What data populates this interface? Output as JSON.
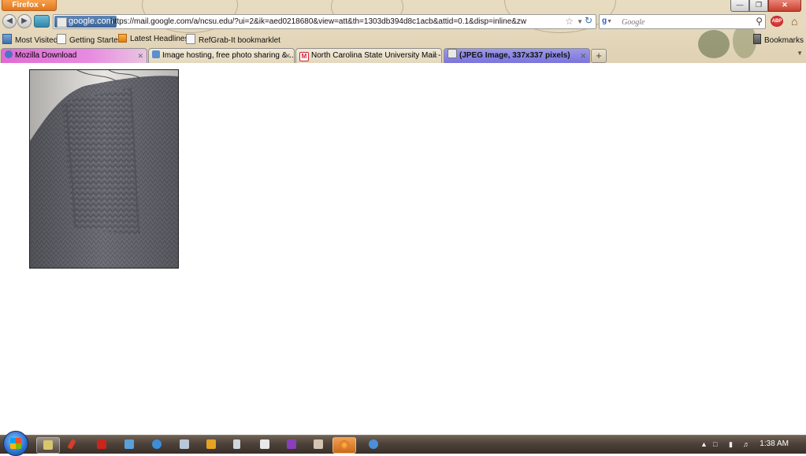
{
  "browser": {
    "menu_button": "Firefox",
    "identity": "google.com",
    "url": "https://mail.google.com/a/ncsu.edu/?ui=2&ik=aed0218680&view=att&th=1303db394d8c1acb&attid=0.1&disp=inline&zw",
    "search_placeholder": "Google",
    "search_engine_icon": "google-icon",
    "adblock_label": "ABP"
  },
  "bookmarks": {
    "items": [
      "Most Visited",
      "Getting Started",
      "Latest Headlines",
      "RefGrab-It bookmarklet"
    ],
    "menu_label": "Bookmarks"
  },
  "tabs": [
    {
      "label": "Mozilla Download"
    },
    {
      "label": "Image hosting, free photo sharing & ..."
    },
    {
      "label": "North Carolina State University Mail - ..."
    },
    {
      "label": "(JPEG Image, 337x337 pixels)",
      "active": true
    }
  ],
  "content": {
    "image_icon": "knitted-sweater-photo"
  },
  "taskbar": {
    "clock": "1:38 AM"
  },
  "colors": {
    "chrome_bg": "#e6d9bd",
    "active_tab": "#8a84e0",
    "first_tab": "#df6ad4",
    "taskbar": "#4d4239"
  }
}
